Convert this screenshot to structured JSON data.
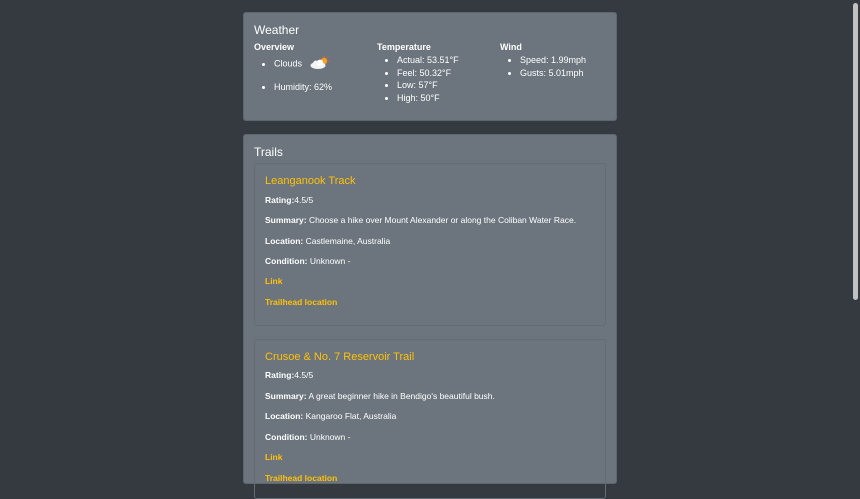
{
  "weather": {
    "title": "Weather",
    "overview": {
      "heading": "Overview",
      "condition": "Clouds",
      "condition_icon": "clouds-sun-icon",
      "humidity": "Humidity: 62%"
    },
    "temperature": {
      "heading": "Temperature",
      "items": [
        "Actual: 53.51°F",
        "Feel: 50.32°F",
        "Low: 57°F",
        "High: 50°F"
      ]
    },
    "wind": {
      "heading": "Wind",
      "items": [
        "Speed: 1.99mph",
        "Gusts: 5.01mph"
      ]
    }
  },
  "trails": {
    "title": "Trails",
    "labels": {
      "rating": "Rating:",
      "summary": "Summary:",
      "location": "Location:",
      "condition": "Condition:"
    },
    "items": [
      {
        "name": "Leanganook Track",
        "rating": "4.5/5",
        "summary": " Choose a hike over Mount Alexander or along the Coliban Water Race.",
        "location": " Castlemaine, Australia",
        "condition": " Unknown -",
        "link_label": "Link",
        "trailhead_label": "Trailhead location"
      },
      {
        "name": "Crusoe & No. 7 Reservoir Trail",
        "rating": "4.5/5",
        "summary": " A great beginner hike in Bendigo's beautiful bush.",
        "location": " Kangaroo Flat, Australia",
        "condition": " Unknown -",
        "link_label": "Link",
        "trailhead_label": "Trailhead location"
      }
    ]
  },
  "colors": {
    "background": "#343a40",
    "card": "#6c757d",
    "accent": "#ffc107",
    "text": "#ffffff"
  }
}
